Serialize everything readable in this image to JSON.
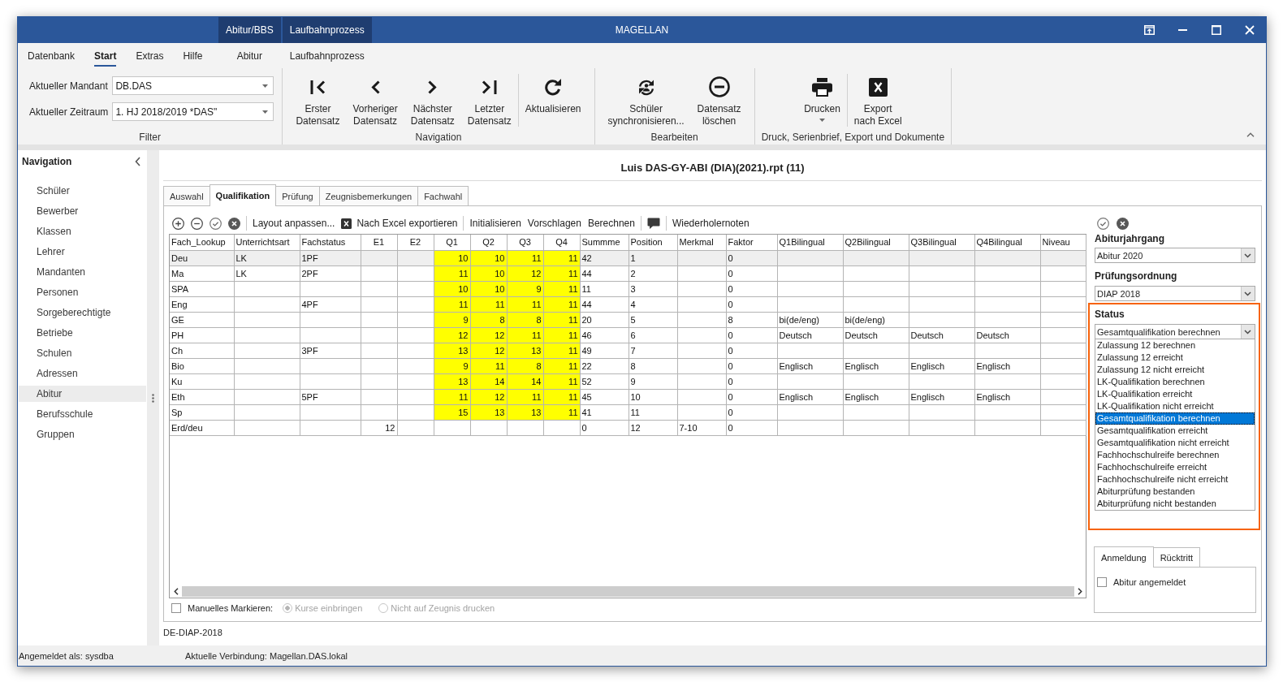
{
  "window": {
    "title": "MAGELLAN",
    "context_tabs": [
      {
        "label": "Abitur/BBS"
      },
      {
        "label": "Laufbahnprozess"
      }
    ]
  },
  "ribbon": {
    "tabs": [
      {
        "label": "Datenbank",
        "kind": "main",
        "selected": false
      },
      {
        "label": "Start",
        "kind": "main",
        "selected": true
      },
      {
        "label": "Extras",
        "kind": "main",
        "selected": false
      },
      {
        "label": "Hilfe",
        "kind": "main",
        "selected": false
      },
      {
        "label": "Abitur",
        "kind": "context",
        "selected": false
      },
      {
        "label": "Laufbahnprozess",
        "kind": "context",
        "selected": false
      }
    ],
    "groups": [
      {
        "label": "Filter",
        "fields": [
          {
            "label": "Aktueller Mandant",
            "value": "DB.DAS"
          },
          {
            "label": "Aktueller Zeitraum",
            "value": "1. HJ 2018/2019 *DAS\""
          }
        ]
      },
      {
        "label": "Navigation",
        "sets": [
          [
            {
              "kind": "first",
              "lines": [
                "Erster",
                "Datensatz"
              ],
              "dropdown": false
            },
            {
              "kind": "previous",
              "lines": [
                "Vorheriger",
                "Datensatz"
              ],
              "dropdown": false
            },
            {
              "kind": "next",
              "lines": [
                "Nächster",
                "Datensatz"
              ],
              "dropdown": false
            },
            {
              "kind": "last",
              "lines": [
                "Letzter",
                "Datensatz"
              ],
              "dropdown": false
            }
          ],
          [
            {
              "kind": "refresh",
              "lines": [
                "Aktualisieren"
              ],
              "dropdown": false
            }
          ]
        ]
      },
      {
        "label": "Bearbeiten",
        "sets": [
          [
            {
              "kind": "sync",
              "lines": [
                "Schüler",
                "synchronisieren..."
              ],
              "dropdown": false
            },
            {
              "kind": "delete",
              "lines": [
                "Datensatz",
                "löschen"
              ],
              "dropdown": false
            }
          ]
        ]
      },
      {
        "label": "Druck, Serienbrief, Export und Dokumente",
        "sets": [
          [
            {
              "kind": "print",
              "lines": [
                "Drucken"
              ],
              "dropdown": true
            }
          ],
          [
            {
              "kind": "excel",
              "lines": [
                "Export",
                "nach Excel"
              ],
              "dropdown": false
            }
          ]
        ]
      }
    ]
  },
  "navigation": {
    "title": "Navigation",
    "items": [
      {
        "label": "Schüler",
        "selected": false
      },
      {
        "label": "Bewerber",
        "selected": false
      },
      {
        "label": "Klassen",
        "selected": false
      },
      {
        "label": "Lehrer",
        "selected": false
      },
      {
        "label": "Mandanten",
        "selected": false
      },
      {
        "label": "Personen",
        "selected": false
      },
      {
        "label": "Sorgeberechtigte",
        "selected": false
      },
      {
        "label": "Betriebe",
        "selected": false
      },
      {
        "label": "Schulen",
        "selected": false
      },
      {
        "label": "Adressen",
        "selected": false
      },
      {
        "label": "Abitur",
        "selected": true
      },
      {
        "label": "Berufsschule",
        "selected": false
      },
      {
        "label": "Gruppen",
        "selected": false
      }
    ]
  },
  "record": {
    "title": "Luis DAS-GY-ABI (DIA)(2021).rpt (11)",
    "tabs": [
      {
        "label": "Auswahl",
        "selected": false
      },
      {
        "label": "Qualifikation",
        "selected": true
      },
      {
        "label": "Prüfung",
        "selected": false
      },
      {
        "label": "Zeugnisbemerkungen",
        "selected": false
      },
      {
        "label": "Fachwahl",
        "selected": false
      }
    ],
    "toolbar": [
      [
        {
          "kind": "add"
        },
        {
          "kind": "remove"
        },
        {
          "kind": "confirm"
        },
        {
          "kind": "cancel"
        }
      ],
      [
        {
          "kind": "text",
          "label": "Layout anpassen..."
        },
        {
          "kind": "excel",
          "label": "Nach Excel exportieren"
        }
      ],
      [
        {
          "kind": "text",
          "label": "Initialisieren"
        },
        {
          "kind": "text",
          "label": "Vorschlagen"
        },
        {
          "kind": "text",
          "label": "Berechnen"
        }
      ],
      [
        {
          "kind": "comment"
        }
      ],
      [
        {
          "kind": "text",
          "label": "Wiederholernoten"
        }
      ]
    ],
    "table": {
      "columns": [
        {
          "label": "Fach_Lookup",
          "kind": "text"
        },
        {
          "label": "Unterrichtsart",
          "kind": "text"
        },
        {
          "label": "Fachstatus",
          "kind": "text"
        },
        {
          "label": "E1",
          "kind": "number"
        },
        {
          "label": "E2",
          "kind": "number"
        },
        {
          "label": "Q1",
          "kind": "grade"
        },
        {
          "label": "Q2",
          "kind": "grade"
        },
        {
          "label": "Q3",
          "kind": "grade"
        },
        {
          "label": "Q4",
          "kind": "grade"
        },
        {
          "label": "Summme",
          "kind": "text"
        },
        {
          "label": "Position",
          "kind": "text"
        },
        {
          "label": "Merkmal",
          "kind": "text"
        },
        {
          "label": "Faktor",
          "kind": "text"
        },
        {
          "label": "Q1Bilingual",
          "kind": "text"
        },
        {
          "label": "Q2Bilingual",
          "kind": "text"
        },
        {
          "label": "Q3Bilingual",
          "kind": "text"
        },
        {
          "label": "Q4Bilingual",
          "kind": "text"
        },
        {
          "label": "Niveau",
          "kind": "text"
        }
      ],
      "rows": [
        {
          "selected": true,
          "counted": true,
          "cells": [
            "Deu",
            "LK",
            "1PF",
            null,
            null,
            "10",
            "10",
            "11",
            "11",
            "42",
            "1",
            null,
            "0",
            null,
            null,
            null,
            null,
            null
          ]
        },
        {
          "selected": false,
          "counted": true,
          "cells": [
            "Ma",
            "LK",
            "2PF",
            null,
            null,
            "11",
            "10",
            "12",
            "11",
            "44",
            "2",
            null,
            "0",
            null,
            null,
            null,
            null,
            null
          ]
        },
        {
          "selected": false,
          "counted": true,
          "cells": [
            "SPA",
            null,
            null,
            null,
            null,
            "10",
            "10",
            "9",
            "11",
            "11",
            "3",
            null,
            "0",
            null,
            null,
            null,
            null,
            null
          ]
        },
        {
          "selected": false,
          "counted": true,
          "cells": [
            "Eng",
            null,
            "4PF",
            null,
            null,
            "11",
            "11",
            "11",
            "11",
            "44",
            "4",
            null,
            "0",
            null,
            null,
            null,
            null,
            null
          ]
        },
        {
          "selected": false,
          "counted": true,
          "cells": [
            "GE",
            null,
            null,
            null,
            null,
            "9",
            "8",
            "8",
            "11",
            "20",
            "5",
            null,
            "8",
            "bi(de/eng)",
            "bi(de/eng)",
            null,
            null,
            null
          ]
        },
        {
          "selected": false,
          "counted": true,
          "cells": [
            "PH",
            null,
            null,
            null,
            null,
            "12",
            "12",
            "11",
            "11",
            "46",
            "6",
            null,
            "0",
            "Deutsch",
            "Deutsch",
            "Deutsch",
            "Deutsch",
            null
          ]
        },
        {
          "selected": false,
          "counted": true,
          "cells": [
            "Ch",
            null,
            "3PF",
            null,
            null,
            "13",
            "12",
            "13",
            "11",
            "49",
            "7",
            null,
            "0",
            null,
            null,
            null,
            null,
            null
          ]
        },
        {
          "selected": false,
          "counted": true,
          "cells": [
            "Bio",
            null,
            null,
            null,
            null,
            "9",
            "11",
            "8",
            "11",
            "22",
            "8",
            null,
            "0",
            "Englisch",
            "Englisch",
            "Englisch",
            "Englisch",
            null
          ]
        },
        {
          "selected": false,
          "counted": true,
          "cells": [
            "Ku",
            null,
            null,
            null,
            null,
            "13",
            "14",
            "14",
            "11",
            "52",
            "9",
            null,
            "0",
            null,
            null,
            null,
            null,
            null
          ]
        },
        {
          "selected": false,
          "counted": true,
          "cells": [
            "Eth",
            null,
            "5PF",
            null,
            null,
            "11",
            "12",
            "11",
            "11",
            "45",
            "10",
            null,
            "0",
            "Englisch",
            "Englisch",
            "Englisch",
            "Englisch",
            null
          ]
        },
        {
          "selected": false,
          "counted": true,
          "cells": [
            "Sp",
            null,
            null,
            null,
            null,
            "15",
            "13",
            "13",
            "11",
            "41",
            "11",
            null,
            "0",
            null,
            null,
            null,
            null,
            null
          ]
        },
        {
          "selected": false,
          "counted": false,
          "cells": [
            "Erd/deu",
            null,
            null,
            "12",
            null,
            null,
            null,
            null,
            null,
            "0",
            "12",
            "7-10",
            "0",
            null,
            null,
            null,
            null,
            null
          ]
        }
      ]
    },
    "marking": {
      "checkbox": {
        "label": "Manuelles Markieren:",
        "checked": false
      },
      "radios": [
        {
          "label": "Kurse einbringen",
          "selected": true,
          "disabled": true
        },
        {
          "label": "Nicht auf Zeugnis drucken",
          "selected": false,
          "disabled": true
        }
      ]
    },
    "side": {
      "actions": [
        {
          "kind": "confirm"
        },
        {
          "kind": "cancel"
        }
      ],
      "fields": [
        {
          "label": "Abiturjahrgang",
          "value": "Abitur 2020"
        },
        {
          "label": "Prüfungsordnung",
          "value": "DIAP 2018"
        }
      ],
      "status": {
        "label": "Status",
        "value": "Gesamtqualifikation berechnen",
        "highlighted": true,
        "expanded": true,
        "options": [
          {
            "label": "Zulassung 12 berechnen",
            "selected": false
          },
          {
            "label": "Zulassung 12 erreicht",
            "selected": false
          },
          {
            "label": "Zulassung 12 nicht erreicht",
            "selected": false
          },
          {
            "label": "LK-Qualifikation berechnen",
            "selected": false
          },
          {
            "label": "LK-Qualifikation erreicht",
            "selected": false
          },
          {
            "label": "LK-Qualifikation nicht erreicht",
            "selected": false
          },
          {
            "label": "Gesamtqualifikation berechnen",
            "selected": true
          },
          {
            "label": "Gesamtqualifikation erreicht",
            "selected": false
          },
          {
            "label": "Gesamtqualifikation nicht erreicht",
            "selected": false
          },
          {
            "label": "Fachhochschulreife berechnen",
            "selected": false
          },
          {
            "label": "Fachhochschulreife erreicht",
            "selected": false
          },
          {
            "label": "Fachhochschulreife nicht erreicht",
            "selected": false
          },
          {
            "label": "Abiturprüfung bestanden",
            "selected": false
          },
          {
            "label": "Abiturprüfung nicht bestanden",
            "selected": false
          }
        ]
      },
      "tabs": [
        {
          "label": "Anmeldung",
          "selected": true
        },
        {
          "label": "Rücktritt",
          "selected": false
        }
      ],
      "checkbox": {
        "label": "Abitur angemeldet",
        "checked": false
      }
    },
    "footer": "DE-DIAP-2018"
  },
  "status_bar": [
    "Angemeldet als: sysdba",
    "Aktuelle Verbindung: Magellan.DAS.lokal"
  ]
}
